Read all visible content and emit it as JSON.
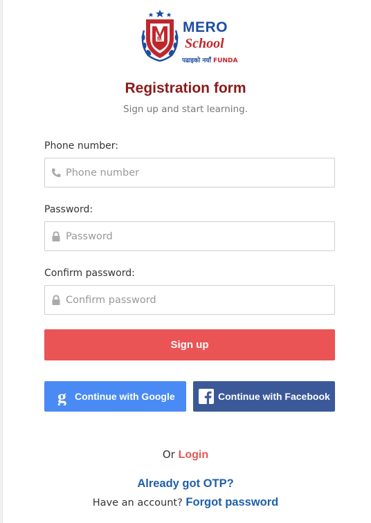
{
  "brand": {
    "name_top": "MERO",
    "name_bottom": "School",
    "tagline_nepali": "पढाइको नयाँ",
    "tagline_funda": "FUNDA",
    "colors": {
      "blue": "#1d4da0",
      "red": "#c0272d"
    }
  },
  "header": {
    "title": "Registration form",
    "subtitle": "Sign up and start learning."
  },
  "form": {
    "phone": {
      "label": "Phone number:",
      "placeholder": "Phone number",
      "value": "",
      "icon": "phone-icon"
    },
    "password": {
      "label": "Password:",
      "placeholder": "Password",
      "value": "",
      "icon": "lock-icon"
    },
    "confirm": {
      "label": "Confirm password:",
      "placeholder": "Confirm password",
      "value": "",
      "icon": "lock-icon"
    },
    "submit_label": "Sign up"
  },
  "social": {
    "google_label": "Continue with Google",
    "facebook_label": "Continue with Facebook",
    "google_color": "#4a8af4",
    "facebook_color": "#3b5998"
  },
  "footer": {
    "or_text": "Or",
    "login_label": "Login",
    "otp_label": "Already got OTP?",
    "account_text": "Have an account?",
    "forgot_label": "Forgot password"
  },
  "colors": {
    "accent": "#ea5455",
    "link": "#1f5fa8",
    "title": "#8b1a1a"
  }
}
